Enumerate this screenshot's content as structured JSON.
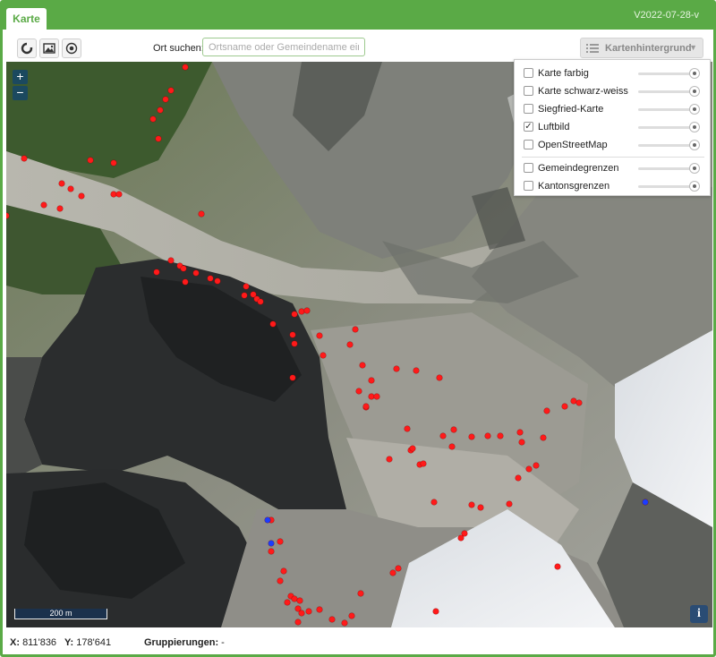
{
  "app": {
    "tab_label": "Karte",
    "version": "V2022-07-28-v"
  },
  "toolbar": {
    "buttons": [
      {
        "name": "locate-button",
        "icon": "refresh-icon"
      },
      {
        "name": "image-button",
        "icon": "image-icon"
      },
      {
        "name": "target-button",
        "icon": "target-icon"
      }
    ],
    "search_label": "Ort suchen:",
    "search_placeholder": "Ortsname oder Gemeindename eing",
    "search_value": "",
    "background_button_label": "Kartenhintergrund",
    "background_button_icon": "list-icon"
  },
  "layers": [
    {
      "label": "Karte farbig",
      "checked": false
    },
    {
      "label": "Karte schwarz-weiss",
      "checked": false
    },
    {
      "label": "Siegfried-Karte",
      "checked": false
    },
    {
      "label": "Luftbild",
      "checked": true
    },
    {
      "label": "OpenStreetMap",
      "checked": false
    },
    {
      "label": "Gemeindegrenzen",
      "checked": false
    },
    {
      "label": "Kantonsgrenzen",
      "checked": false
    }
  ],
  "map": {
    "zoom_in": "+",
    "zoom_out": "−",
    "scale_label": "200 m",
    "info_label": "i",
    "marker_colors": {
      "observation": "#ff1a1a",
      "special": "#1a3cff"
    }
  },
  "status": {
    "x_label": "X:",
    "x_value": "811'836",
    "y_label": "Y:",
    "y_value": "178'641",
    "grouping_label": "Gruppierungen:",
    "grouping_value": "-"
  }
}
